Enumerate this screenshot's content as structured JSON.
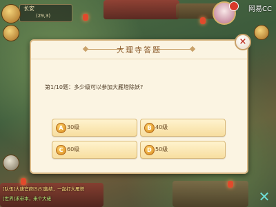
{
  "hud": {
    "location": "长安",
    "coords": "(29,3)",
    "watermark": "网易CC"
  },
  "dialog": {
    "title": "大理寺答题",
    "close_glyph": "×",
    "question": "第1/10题：多少级可以参加大雁塔除妖?",
    "options": [
      {
        "letter": "A",
        "text": "30级"
      },
      {
        "letter": "B",
        "text": "40级"
      },
      {
        "letter": "C",
        "text": "60级"
      },
      {
        "letter": "D",
        "text": "50级"
      }
    ]
  },
  "chat": {
    "line1": "[队伍]大唐官府[5/5]集结，一起打大雁塔",
    "line2": "[世界]求带本，来个大佬"
  },
  "colors": {
    "dialog_bg": "#fbf4e2",
    "title_color": "#8a5a2b",
    "option_bg": "#f7dea0",
    "close_color": "#c0392b"
  }
}
